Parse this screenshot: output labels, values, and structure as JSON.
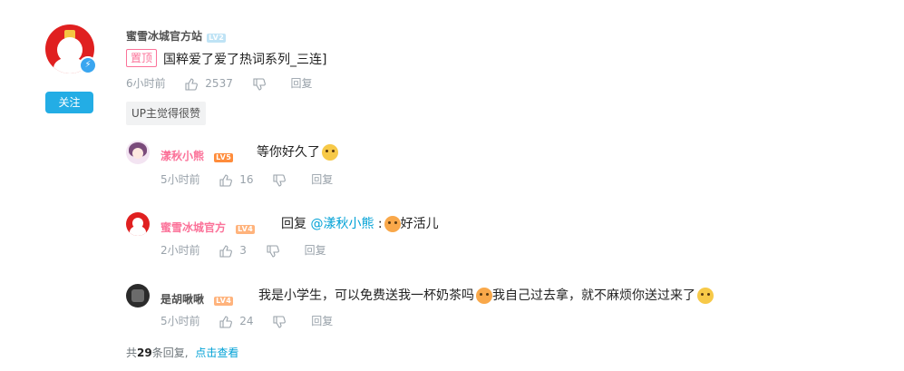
{
  "main_comment": {
    "username": "蜜雪冰城官方站",
    "level": "LV2",
    "pinned_tag": "置顶",
    "content": "国粹爱了爱了热词系列_三连]",
    "time": "6小时前",
    "likes": "2537",
    "reply_label": "回复",
    "follow_label": "关注",
    "up_badge": "UP主觉得很赞"
  },
  "replies": [
    {
      "username": "漾秋小熊",
      "level": "LV5",
      "content": "等你好久了",
      "emoji": "grin-face-icon",
      "time": "5小时前",
      "likes": "16",
      "reply_label": "回复"
    },
    {
      "username": "蜜雪冰城官方",
      "level": "LV4",
      "reply_prefix": "回复",
      "mention": "@漾秋小熊",
      "colon": ":",
      "content": "好活儿",
      "time": "2小时前",
      "likes": "3",
      "reply_label": "回复"
    },
    {
      "username": "是胡啾啾",
      "level": "LV4",
      "content_a": "我是小学生，可以免费送我一杯奶茶吗",
      "content_b": "我自己过去拿，就不麻烦你送过来了",
      "time": "5小时前",
      "likes": "24",
      "reply_label": "回复"
    }
  ],
  "footer": {
    "prefix": "共",
    "count": "29",
    "suffix": "条回复,",
    "view_link": "点击查看"
  }
}
